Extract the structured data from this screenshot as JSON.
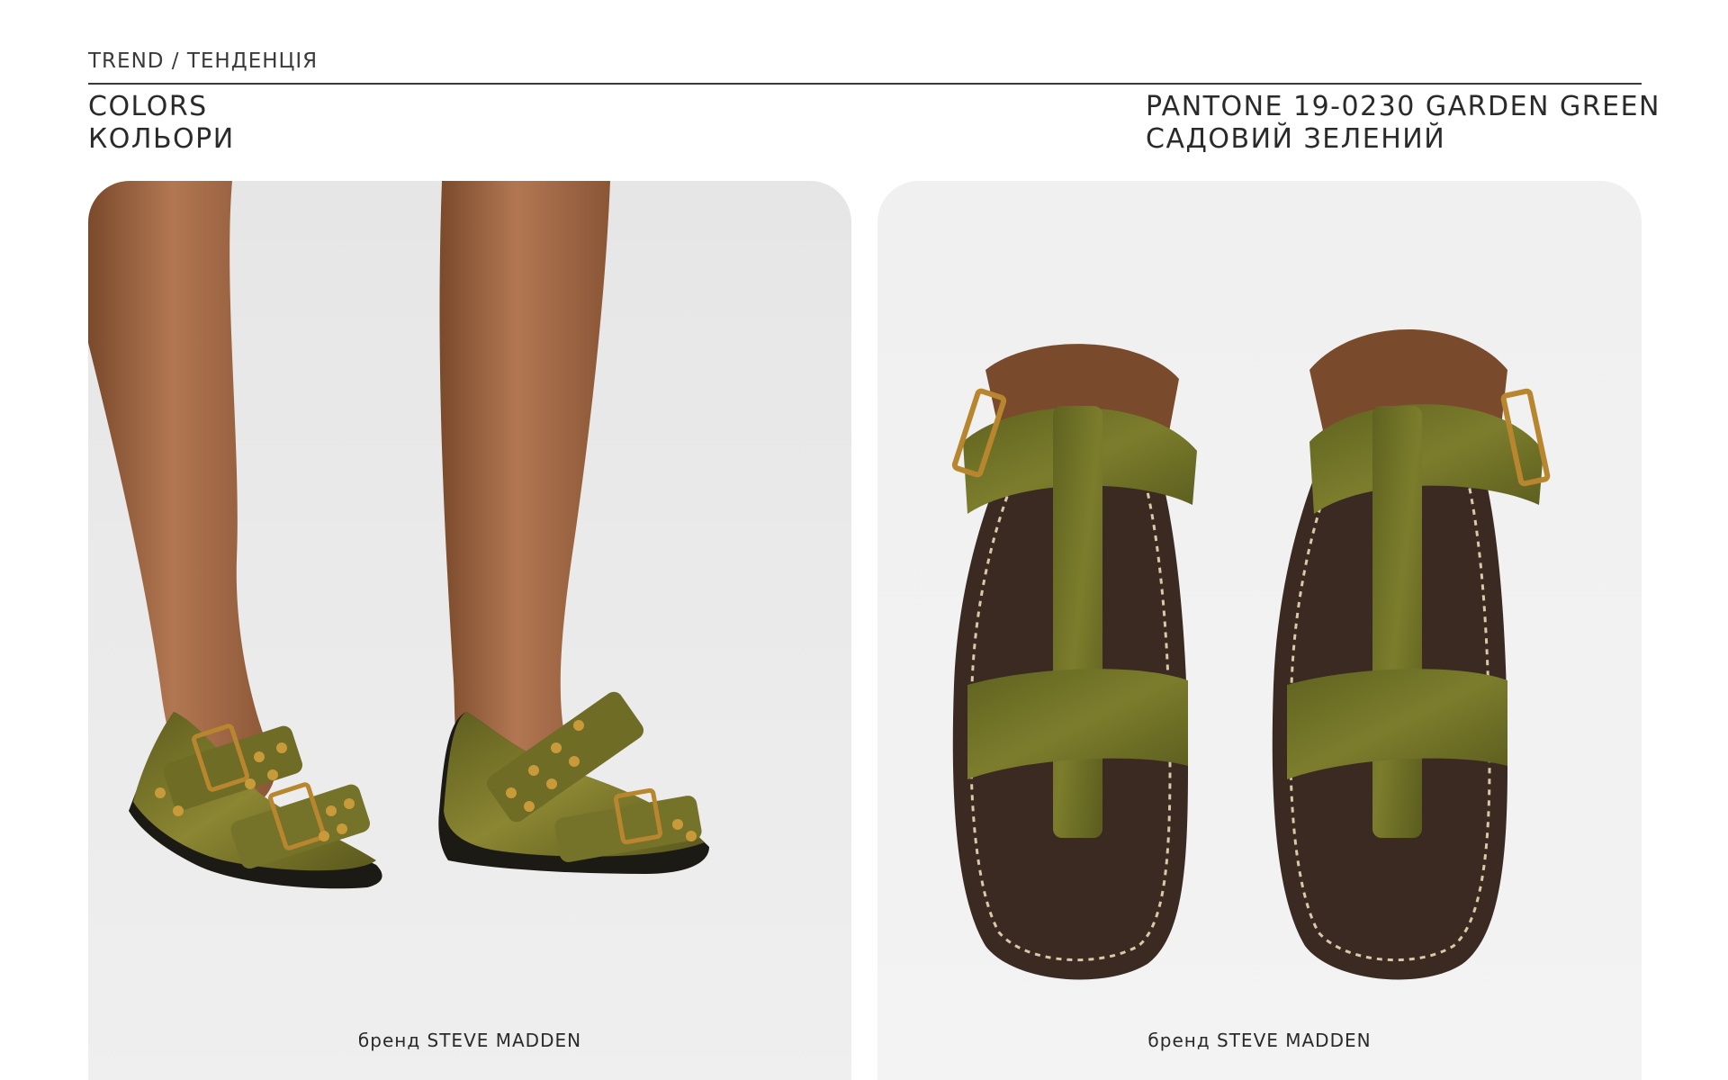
{
  "header": {
    "breadcrumb": "TREND / ТЕНДЕНЦІЯ",
    "section_en": "COLORS",
    "section_ua": "КОЛЬОРИ",
    "color_en": "PANTONE 19-0230 GARDEN GREEN",
    "color_ua": "САДОВИЙ ЗЕЛЕНИЙ"
  },
  "cards": [
    {
      "image": "model-wearing-green-satin-buckle-flats",
      "caption": "бренд STEVE MADDEN"
    },
    {
      "image": "green-calf-hair-t-strap-sandals",
      "caption": "бренд STEVE MADDEN"
    }
  ],
  "colors": {
    "garden_green": "#6b6a26",
    "leather_dark": "#3a2a22",
    "buckle_gold": "#b8862e",
    "skin": "#a8704a"
  }
}
